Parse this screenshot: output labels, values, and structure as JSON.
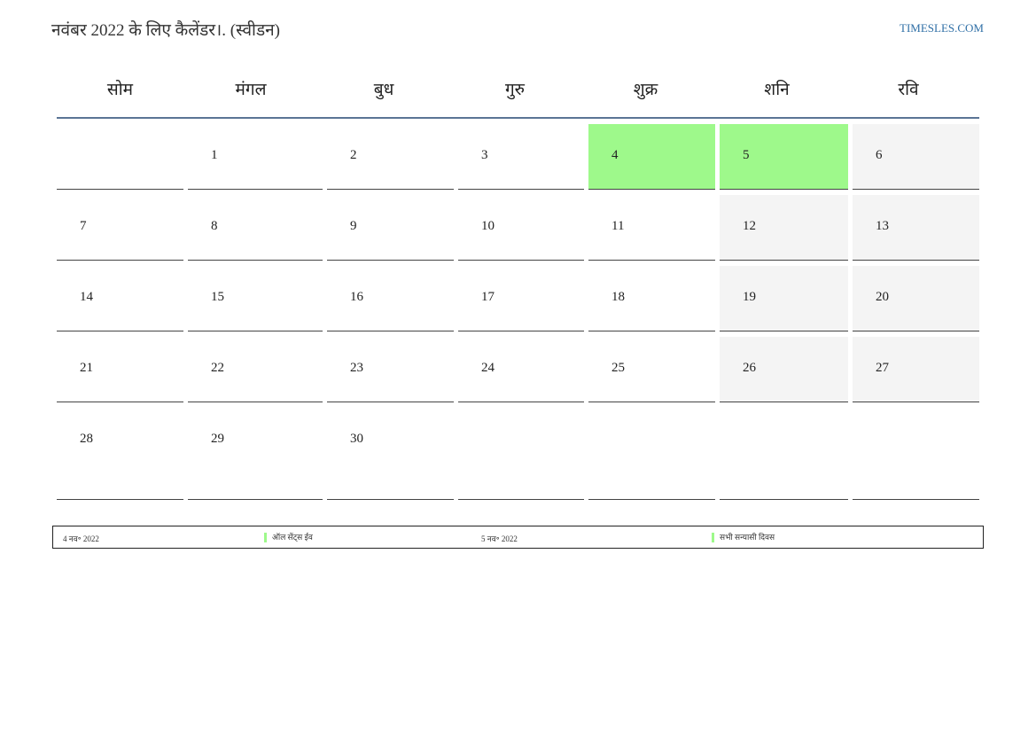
{
  "title": "नवंबर 2022 के लिए कैलेंडर।. (स्वीडन)",
  "site": "TIMESLES.COM",
  "weekdays": [
    "सोम",
    "मंगल",
    "बुध",
    "गुरु",
    "शुक्र",
    "शनि",
    "रवि"
  ],
  "weeks": [
    [
      {
        "d": ""
      },
      {
        "d": "1"
      },
      {
        "d": "2"
      },
      {
        "d": "3"
      },
      {
        "d": "4",
        "t": "holiday"
      },
      {
        "d": "5",
        "t": "holiday"
      },
      {
        "d": "6",
        "t": "weekend"
      }
    ],
    [
      {
        "d": "7"
      },
      {
        "d": "8"
      },
      {
        "d": "9"
      },
      {
        "d": "10"
      },
      {
        "d": "11"
      },
      {
        "d": "12",
        "t": "weekend"
      },
      {
        "d": "13",
        "t": "weekend"
      }
    ],
    [
      {
        "d": "14"
      },
      {
        "d": "15"
      },
      {
        "d": "16"
      },
      {
        "d": "17"
      },
      {
        "d": "18"
      },
      {
        "d": "19",
        "t": "weekend"
      },
      {
        "d": "20",
        "t": "weekend"
      }
    ],
    [
      {
        "d": "21"
      },
      {
        "d": "22"
      },
      {
        "d": "23"
      },
      {
        "d": "24"
      },
      {
        "d": "25"
      },
      {
        "d": "26",
        "t": "weekend"
      },
      {
        "d": "27",
        "t": "weekend"
      }
    ],
    [
      {
        "d": "28"
      },
      {
        "d": "29"
      },
      {
        "d": "30"
      },
      {
        "d": ""
      },
      {
        "d": ""
      },
      {
        "d": ""
      },
      {
        "d": ""
      }
    ]
  ],
  "legend": [
    {
      "date": "4 नव॰ 2022",
      "name": "ऑल सेंट्स ईव"
    },
    {
      "date": "5 नव॰ 2022",
      "name": "सभी सन्यासी दिवस"
    }
  ],
  "colors": {
    "holiday": "#9ef98b",
    "weekend": "#f4f4f4",
    "header_rule": "#5a7495",
    "link": "#2f6fa6"
  }
}
